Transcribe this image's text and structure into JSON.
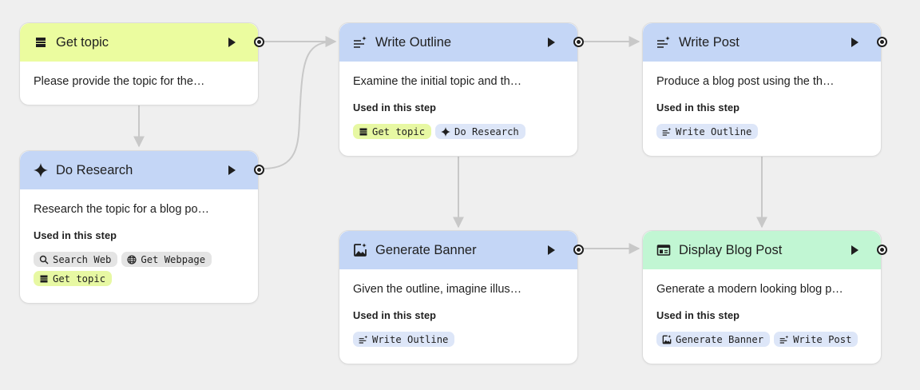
{
  "colors": {
    "input_header": "#ebfc9f",
    "generate_header": "#c4d6f6",
    "output_header": "#c1f6d3",
    "connector": "#c8c8c8",
    "canvas": "#efefef"
  },
  "nodes": {
    "get_topic": {
      "title": "Get topic",
      "icon": "input-icon",
      "description": "Please provide the topic for the…"
    },
    "do_research": {
      "title": "Do Research",
      "icon": "sparkle-icon",
      "description": "Research the topic for a blog po…",
      "used_label": "Used in this step",
      "chips": [
        {
          "label": "Search Web",
          "icon": "search-icon"
        },
        {
          "label": "Get Webpage",
          "icon": "globe-icon"
        },
        {
          "label": "Get topic",
          "icon": "input-icon"
        }
      ]
    },
    "write_outline": {
      "title": "Write Outline",
      "icon": "text-sparkle-icon",
      "description": "Examine the initial topic and th…",
      "used_label": "Used in this step",
      "chips": [
        {
          "label": "Get topic",
          "icon": "input-icon"
        },
        {
          "label": "Do Research",
          "icon": "sparkle-icon"
        }
      ]
    },
    "write_post": {
      "title": "Write Post",
      "icon": "text-sparkle-icon",
      "description": "Produce a blog post using the th…",
      "used_label": "Used in this step",
      "chips": [
        {
          "label": "Write Outline",
          "icon": "text-sparkle-icon"
        }
      ]
    },
    "generate_banner": {
      "title": "Generate Banner",
      "icon": "image-sparkle-icon",
      "description": "Given the outline, imagine illus…",
      "used_label": "Used in this step",
      "chips": [
        {
          "label": "Write Outline",
          "icon": "text-sparkle-icon"
        }
      ]
    },
    "display_blog_post": {
      "title": "Display Blog Post",
      "icon": "display-icon",
      "description": "Generate a modern looking blog p…",
      "used_label": "Used in this step",
      "chips": [
        {
          "label": "Generate Banner",
          "icon": "image-sparkle-icon"
        },
        {
          "label": "Write Post",
          "icon": "text-sparkle-icon"
        }
      ]
    }
  }
}
